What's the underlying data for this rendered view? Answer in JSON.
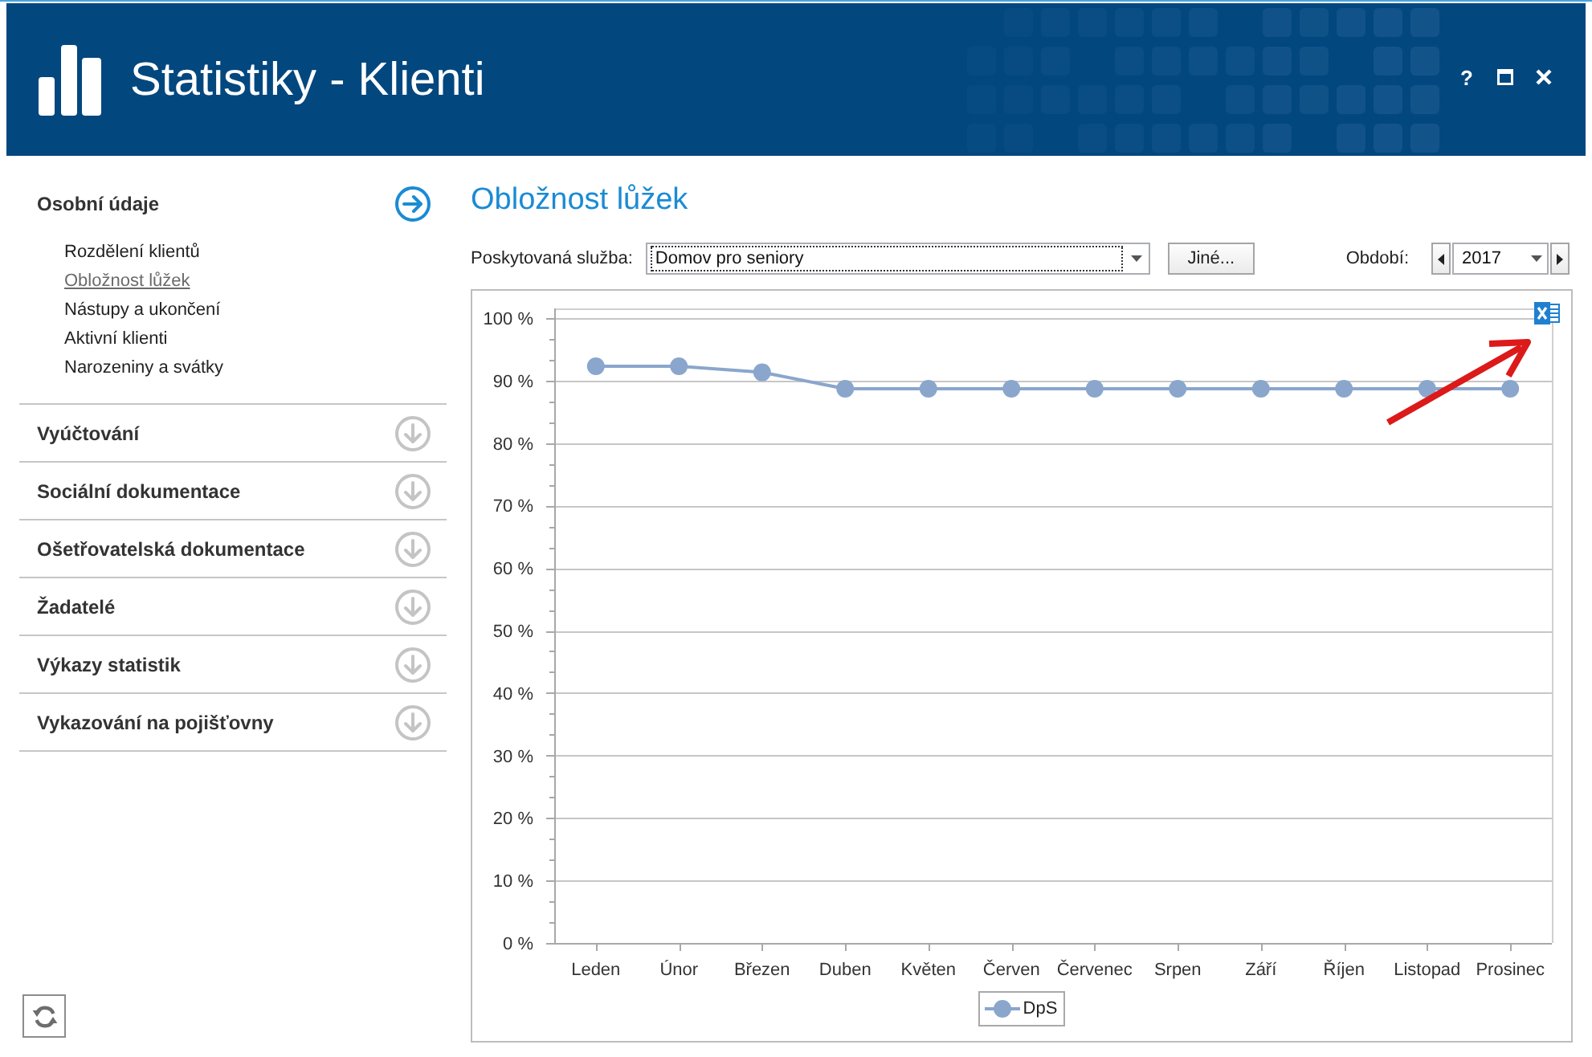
{
  "window": {
    "title": "Statistiky - Klienti",
    "controls": [
      {
        "kind": "help",
        "label": "?"
      },
      {
        "kind": "maximize"
      },
      {
        "kind": "close"
      }
    ]
  },
  "sidebar": {
    "sections": [
      {
        "title": "Osobní údaje",
        "expanded": true,
        "items": [
          {
            "label": "Rozdělení klientů",
            "selected": false
          },
          {
            "label": "Obložnost lůžek",
            "selected": true
          },
          {
            "label": "Nástupy a ukončení",
            "selected": false
          },
          {
            "label": "Aktivní klienti",
            "selected": false
          },
          {
            "label": "Narozeniny a svátky",
            "selected": false
          }
        ]
      },
      {
        "title": "Vyúčtování",
        "expanded": false
      },
      {
        "title": "Sociální dokumentace",
        "expanded": false
      },
      {
        "title": "Ošetřovatelská dokumentace",
        "expanded": false
      },
      {
        "title": "Žadatelé",
        "expanded": false
      },
      {
        "title": "Výkazy statistik",
        "expanded": false
      },
      {
        "title": "Vykazování na pojišťovny",
        "expanded": false
      }
    ]
  },
  "report": {
    "title": "Obložnost lůžek",
    "service": {
      "label": "Poskytovaná služba:",
      "value": "Domov pro seniory",
      "focused": true
    },
    "other_button": "Jiné...",
    "period": {
      "label": "Období:",
      "value": "2017"
    },
    "chart": {
      "annotation_arrow": true,
      "chart_data": {
        "type": "line",
        "grid": true,
        "categories": [
          "Leden",
          "Únor",
          "Březen",
          "Duben",
          "Květen",
          "Červen",
          "Červenec",
          "Srpen",
          "Září",
          "Říjen",
          "Listopad",
          "Prosinec"
        ],
        "series": [
          {
            "name": "DpS",
            "color": "#8aa6cc",
            "marker": "circle",
            "values": [
              92.3,
              92.3,
              91.3,
              88.7,
              88.7,
              88.7,
              88.7,
              88.7,
              88.7,
              88.7,
              88.7,
              88.7
            ]
          }
        ],
        "ylim": [
          0,
          100
        ],
        "yticks": [
          {
            "value": 0,
            "label": "0 %"
          },
          {
            "value": 10,
            "label": "10 %"
          },
          {
            "value": 20,
            "label": "20 %"
          },
          {
            "value": 30,
            "label": "30 %"
          },
          {
            "value": 40,
            "label": "40 %"
          },
          {
            "value": 50,
            "label": "50 %"
          },
          {
            "value": 60,
            "label": "60 %"
          },
          {
            "value": 70,
            "label": "70 %"
          },
          {
            "value": 80,
            "label": "80 %"
          },
          {
            "value": 90,
            "label": "90 %"
          },
          {
            "value": 100,
            "label": "100 %"
          }
        ]
      }
    }
  }
}
